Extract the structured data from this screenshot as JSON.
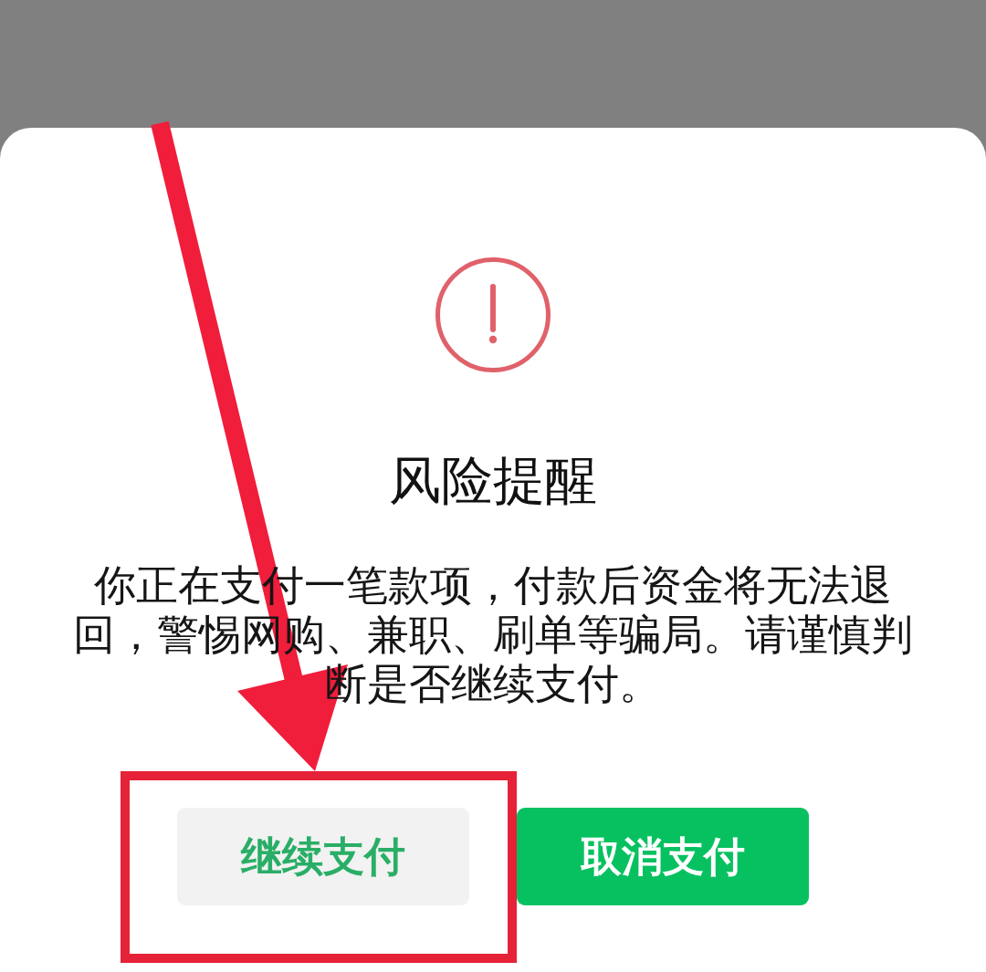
{
  "dialog": {
    "title": "风险提醒",
    "message": "你正在支付一笔款项，付款后资金将无法退回，警惕网购、兼职、刷单等骗局。请谨慎判断是否继续支付。",
    "buttons": [
      {
        "label": "继续支付",
        "kind": "secondary",
        "highlighted": true
      },
      {
        "label": "取消支付",
        "kind": "primary",
        "highlighted": false
      }
    ]
  }
}
